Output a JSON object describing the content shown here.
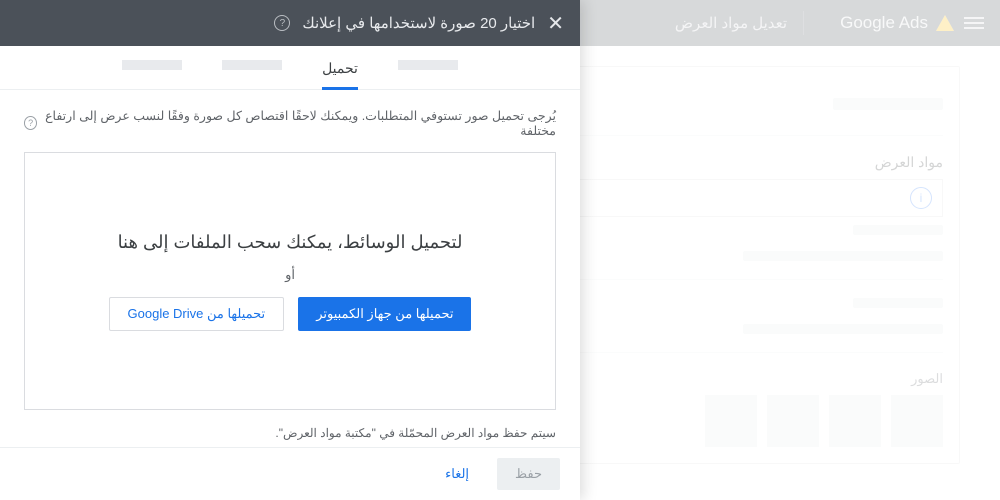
{
  "header": {
    "brand": "Google Ads",
    "section": "تعديل مواد العرض"
  },
  "background": {
    "assets_label": "مواد العرض",
    "images_label": "الصور"
  },
  "modal": {
    "title": "اختيار 20 صورة لاستخدامها في إعلانك",
    "tabs": {
      "upload": "تحميل"
    },
    "hint": "يُرجى تحميل صور تستوفي المتطلبات. ويمكنك لاحقًا اقتصاص كل صورة وفقًا لنسب عرض إلى ارتفاع مختلفة",
    "dropzone": {
      "text": "لتحميل الوسائط، يمكنك سحب الملفات إلى هنا",
      "or": "أو",
      "btn_computer": "تحميلها من جهاز الكمبيوتر",
      "btn_drive": "تحميلها من Google Drive"
    },
    "note": "سيتم حفظ مواد العرض المحمّلة في \"مكتبة مواد العرض\".",
    "footer": {
      "save": "حفظ",
      "cancel": "إلغاء"
    }
  }
}
